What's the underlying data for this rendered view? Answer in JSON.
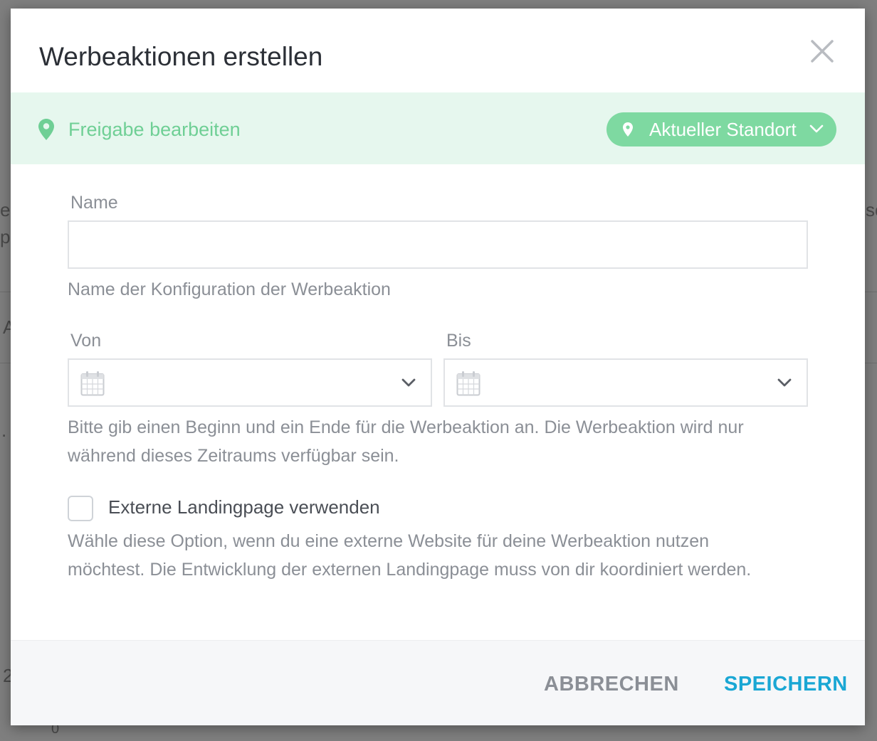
{
  "modal": {
    "title": "Werbeaktionen erstellen",
    "close_icon": "close-icon"
  },
  "share_bar": {
    "label": "Freigabe bearbeiten",
    "icon": "map-pin-icon",
    "location_button": {
      "label": "Aktueller Standort",
      "icon": "map-pin-icon",
      "chevron": "chevron-down-icon"
    },
    "colors": {
      "background": "#e6f7ee",
      "accent": "#6fcf95",
      "pill": "#7ed9a1"
    }
  },
  "form": {
    "name": {
      "label": "Name",
      "value": "",
      "placeholder": "",
      "help": "Name der Konfiguration der Werbeaktion"
    },
    "from": {
      "label": "Von",
      "value": "",
      "icon": "calendar-icon"
    },
    "to": {
      "label": "Bis",
      "value": "",
      "icon": "calendar-icon"
    },
    "date_help_line1": "Bitte gib einen Beginn und ein Ende für die Werbeaktion an. Die Werbeaktion wird nur",
    "date_help_line2": "während dieses Zeitraums verfügbar sein.",
    "external_landing": {
      "label": "Externe Landingpage verwenden",
      "checked": false,
      "help_line1": "Wähle diese Option, wenn du eine externe Website für deine Werbeaktion nutzen",
      "help_line2": "möchtest. Die Entwicklung der externen Landingpage muss von dir koordiniert werden."
    }
  },
  "footer": {
    "cancel_label": "ABBRECHEN",
    "save_label": "SPEICHERN",
    "colors": {
      "save": "#1aa7d4",
      "cancel": "#8b8f96"
    }
  }
}
